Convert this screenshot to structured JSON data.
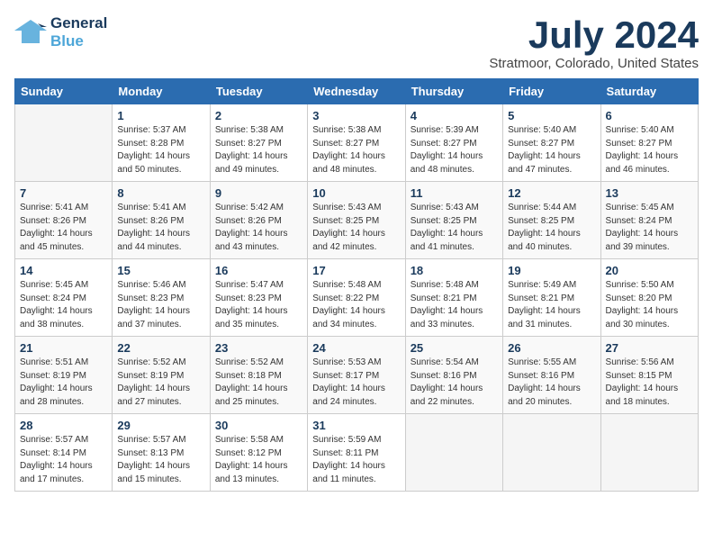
{
  "logo": {
    "line1": "General",
    "line2": "Blue"
  },
  "title": "July 2024",
  "location": "Stratmoor, Colorado, United States",
  "weekdays": [
    "Sunday",
    "Monday",
    "Tuesday",
    "Wednesday",
    "Thursday",
    "Friday",
    "Saturday"
  ],
  "weeks": [
    [
      {
        "day": "",
        "sunrise": "",
        "sunset": "",
        "daylight": "",
        "minutes": ""
      },
      {
        "day": "1",
        "sunrise": "Sunrise: 5:37 AM",
        "sunset": "Sunset: 8:28 PM",
        "daylight": "Daylight: 14 hours",
        "minutes": "and 50 minutes."
      },
      {
        "day": "2",
        "sunrise": "Sunrise: 5:38 AM",
        "sunset": "Sunset: 8:27 PM",
        "daylight": "Daylight: 14 hours",
        "minutes": "and 49 minutes."
      },
      {
        "day": "3",
        "sunrise": "Sunrise: 5:38 AM",
        "sunset": "Sunset: 8:27 PM",
        "daylight": "Daylight: 14 hours",
        "minutes": "and 48 minutes."
      },
      {
        "day": "4",
        "sunrise": "Sunrise: 5:39 AM",
        "sunset": "Sunset: 8:27 PM",
        "daylight": "Daylight: 14 hours",
        "minutes": "and 48 minutes."
      },
      {
        "day": "5",
        "sunrise": "Sunrise: 5:40 AM",
        "sunset": "Sunset: 8:27 PM",
        "daylight": "Daylight: 14 hours",
        "minutes": "and 47 minutes."
      },
      {
        "day": "6",
        "sunrise": "Sunrise: 5:40 AM",
        "sunset": "Sunset: 8:27 PM",
        "daylight": "Daylight: 14 hours",
        "minutes": "and 46 minutes."
      }
    ],
    [
      {
        "day": "7",
        "sunrise": "Sunrise: 5:41 AM",
        "sunset": "Sunset: 8:26 PM",
        "daylight": "Daylight: 14 hours",
        "minutes": "and 45 minutes."
      },
      {
        "day": "8",
        "sunrise": "Sunrise: 5:41 AM",
        "sunset": "Sunset: 8:26 PM",
        "daylight": "Daylight: 14 hours",
        "minutes": "and 44 minutes."
      },
      {
        "day": "9",
        "sunrise": "Sunrise: 5:42 AM",
        "sunset": "Sunset: 8:26 PM",
        "daylight": "Daylight: 14 hours",
        "minutes": "and 43 minutes."
      },
      {
        "day": "10",
        "sunrise": "Sunrise: 5:43 AM",
        "sunset": "Sunset: 8:25 PM",
        "daylight": "Daylight: 14 hours",
        "minutes": "and 42 minutes."
      },
      {
        "day": "11",
        "sunrise": "Sunrise: 5:43 AM",
        "sunset": "Sunset: 8:25 PM",
        "daylight": "Daylight: 14 hours",
        "minutes": "and 41 minutes."
      },
      {
        "day": "12",
        "sunrise": "Sunrise: 5:44 AM",
        "sunset": "Sunset: 8:25 PM",
        "daylight": "Daylight: 14 hours",
        "minutes": "and 40 minutes."
      },
      {
        "day": "13",
        "sunrise": "Sunrise: 5:45 AM",
        "sunset": "Sunset: 8:24 PM",
        "daylight": "Daylight: 14 hours",
        "minutes": "and 39 minutes."
      }
    ],
    [
      {
        "day": "14",
        "sunrise": "Sunrise: 5:45 AM",
        "sunset": "Sunset: 8:24 PM",
        "daylight": "Daylight: 14 hours",
        "minutes": "and 38 minutes."
      },
      {
        "day": "15",
        "sunrise": "Sunrise: 5:46 AM",
        "sunset": "Sunset: 8:23 PM",
        "daylight": "Daylight: 14 hours",
        "minutes": "and 37 minutes."
      },
      {
        "day": "16",
        "sunrise": "Sunrise: 5:47 AM",
        "sunset": "Sunset: 8:23 PM",
        "daylight": "Daylight: 14 hours",
        "minutes": "and 35 minutes."
      },
      {
        "day": "17",
        "sunrise": "Sunrise: 5:48 AM",
        "sunset": "Sunset: 8:22 PM",
        "daylight": "Daylight: 14 hours",
        "minutes": "and 34 minutes."
      },
      {
        "day": "18",
        "sunrise": "Sunrise: 5:48 AM",
        "sunset": "Sunset: 8:21 PM",
        "daylight": "Daylight: 14 hours",
        "minutes": "and 33 minutes."
      },
      {
        "day": "19",
        "sunrise": "Sunrise: 5:49 AM",
        "sunset": "Sunset: 8:21 PM",
        "daylight": "Daylight: 14 hours",
        "minutes": "and 31 minutes."
      },
      {
        "day": "20",
        "sunrise": "Sunrise: 5:50 AM",
        "sunset": "Sunset: 8:20 PM",
        "daylight": "Daylight: 14 hours",
        "minutes": "and 30 minutes."
      }
    ],
    [
      {
        "day": "21",
        "sunrise": "Sunrise: 5:51 AM",
        "sunset": "Sunset: 8:19 PM",
        "daylight": "Daylight: 14 hours",
        "minutes": "and 28 minutes."
      },
      {
        "day": "22",
        "sunrise": "Sunrise: 5:52 AM",
        "sunset": "Sunset: 8:19 PM",
        "daylight": "Daylight: 14 hours",
        "minutes": "and 27 minutes."
      },
      {
        "day": "23",
        "sunrise": "Sunrise: 5:52 AM",
        "sunset": "Sunset: 8:18 PM",
        "daylight": "Daylight: 14 hours",
        "minutes": "and 25 minutes."
      },
      {
        "day": "24",
        "sunrise": "Sunrise: 5:53 AM",
        "sunset": "Sunset: 8:17 PM",
        "daylight": "Daylight: 14 hours",
        "minutes": "and 24 minutes."
      },
      {
        "day": "25",
        "sunrise": "Sunrise: 5:54 AM",
        "sunset": "Sunset: 8:16 PM",
        "daylight": "Daylight: 14 hours",
        "minutes": "and 22 minutes."
      },
      {
        "day": "26",
        "sunrise": "Sunrise: 5:55 AM",
        "sunset": "Sunset: 8:16 PM",
        "daylight": "Daylight: 14 hours",
        "minutes": "and 20 minutes."
      },
      {
        "day": "27",
        "sunrise": "Sunrise: 5:56 AM",
        "sunset": "Sunset: 8:15 PM",
        "daylight": "Daylight: 14 hours",
        "minutes": "and 18 minutes."
      }
    ],
    [
      {
        "day": "28",
        "sunrise": "Sunrise: 5:57 AM",
        "sunset": "Sunset: 8:14 PM",
        "daylight": "Daylight: 14 hours",
        "minutes": "and 17 minutes."
      },
      {
        "day": "29",
        "sunrise": "Sunrise: 5:57 AM",
        "sunset": "Sunset: 8:13 PM",
        "daylight": "Daylight: 14 hours",
        "minutes": "and 15 minutes."
      },
      {
        "day": "30",
        "sunrise": "Sunrise: 5:58 AM",
        "sunset": "Sunset: 8:12 PM",
        "daylight": "Daylight: 14 hours",
        "minutes": "and 13 minutes."
      },
      {
        "day": "31",
        "sunrise": "Sunrise: 5:59 AM",
        "sunset": "Sunset: 8:11 PM",
        "daylight": "Daylight: 14 hours",
        "minutes": "and 11 minutes."
      },
      {
        "day": "",
        "sunrise": "",
        "sunset": "",
        "daylight": "",
        "minutes": ""
      },
      {
        "day": "",
        "sunrise": "",
        "sunset": "",
        "daylight": "",
        "minutes": ""
      },
      {
        "day": "",
        "sunrise": "",
        "sunset": "",
        "daylight": "",
        "minutes": ""
      }
    ]
  ]
}
